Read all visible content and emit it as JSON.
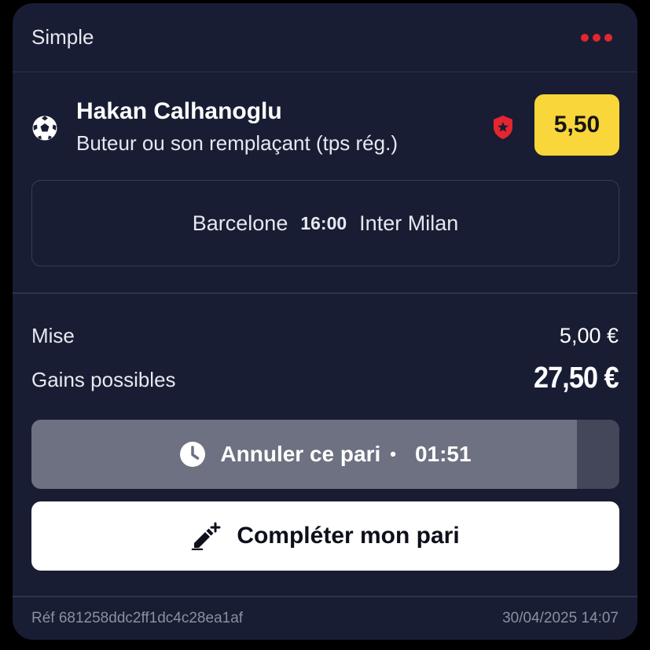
{
  "header": {
    "title": "Simple",
    "menu_icon": "more-dots-icon"
  },
  "selection": {
    "sport_icon": "soccer-ball-icon",
    "player": "Hakan Calhanoglu",
    "market": "Buteur ou son remplaçant (tps rég.)",
    "badge_icon": "shield-star-icon",
    "odds": "5,50"
  },
  "match": {
    "home": "Barcelone",
    "time": "16:00",
    "away": "Inter Milan"
  },
  "summary": {
    "stake_label": "Mise",
    "stake_value": "5,00 €",
    "gains_label": "Gains possibles",
    "gains_value": "27,50 €"
  },
  "cancel": {
    "icon": "clock-icon",
    "label": "Annuler ce pari",
    "separator": "•",
    "countdown": "01:51",
    "progress": 0.928
  },
  "complete": {
    "icon": "pencil-plus-icon",
    "label": "Compléter mon pari"
  },
  "footer": {
    "reference": "Réf 681258ddc2ff1dc4c28ea1af",
    "datetime": "30/04/2025 14:07"
  },
  "colors": {
    "card_bg": "#181d33",
    "accent_red": "#e3262f",
    "odds_yellow": "#f9d63a",
    "cancel_progress": "#6e7181",
    "cancel_track": "#434759"
  }
}
